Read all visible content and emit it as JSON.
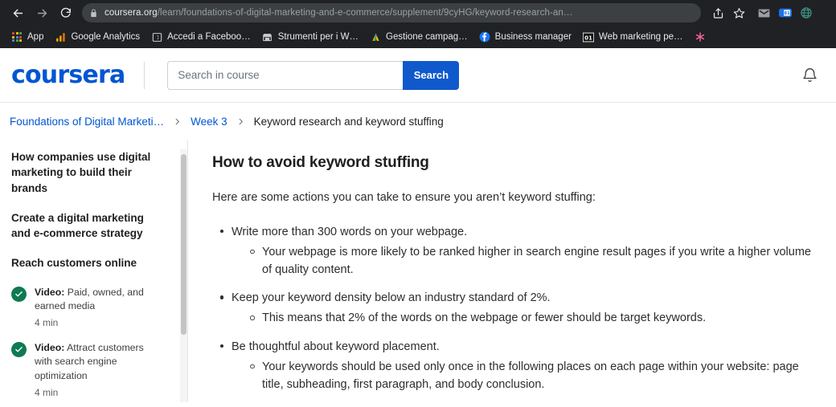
{
  "browser": {
    "back_icon": "back-arrow-icon",
    "forward_icon": "forward-arrow-icon",
    "reload_icon": "reload-icon",
    "lock_icon": "lock-icon",
    "url_host": "coursera.org",
    "url_path": "/learn/foundations-of-digital-marketing-and-e-commerce/supplement/9cyHG/keyword-research-an…",
    "url_full": "coursera.org/learn/foundations-of-digital-marketing-and-e-commerce/supplement/9cyHG/keyword-research-an…",
    "share_icon": "share-icon",
    "bookmark_icon": "star-icon",
    "extensions": [
      {
        "name": "gmail-extension-icon",
        "glyph": "M",
        "color": "#9aa0a6"
      },
      {
        "name": "blue-badge-extension-icon",
        "glyph": "81",
        "color": "#1a73e8"
      },
      {
        "name": "globe-extension-icon",
        "glyph": "globe",
        "color": "#3d9b8f"
      }
    ],
    "bookmarks": [
      {
        "label": "App",
        "icon": "apps-grid-icon"
      },
      {
        "label": "Google Analytics",
        "icon": "google-analytics-icon"
      },
      {
        "label": "Accedi a Faceboo…",
        "icon": "facebook-login-icon"
      },
      {
        "label": "Strumenti per i W…",
        "icon": "webmaster-tools-icon"
      },
      {
        "label": "Gestione campag…",
        "icon": "google-ads-icon"
      },
      {
        "label": "Business manager",
        "icon": "facebook-icon"
      },
      {
        "label": "Web marketing pe…",
        "icon": "numbered-01-icon"
      },
      {
        "label": "",
        "icon": "asterisk-icon"
      }
    ]
  },
  "header": {
    "logo_text": "coursera",
    "search": {
      "placeholder": "Search in course",
      "value": "",
      "button_label": "Search"
    },
    "notifications_icon": "bell-icon"
  },
  "breadcrumb": {
    "items": [
      {
        "label": "Foundations of Digital Marketi…",
        "current": false
      },
      {
        "label": "Week 3",
        "current": false
      },
      {
        "label": "Keyword research and keyword stuffing",
        "current": true
      }
    ],
    "separator_icon": "chevron-right-icon"
  },
  "sidebar": {
    "headings": [
      "How companies use digital marketing to build their brands",
      "Create a digital marketing and e-commerce strategy",
      "Reach customers online"
    ],
    "lessons": [
      {
        "status_icon": "check-circle-icon",
        "kind": "Video:",
        "title": " Paid, owned, and earned media",
        "duration": "4 min"
      },
      {
        "status_icon": "check-circle-icon",
        "kind": "Video:",
        "title": " Attract customers with search engine optimization",
        "duration": "4 min"
      }
    ],
    "scrollbar": "vertical-scrollbar"
  },
  "main": {
    "title": "How to avoid keyword stuffing",
    "intro": "Here are some actions you can take to ensure you aren’t keyword stuffing:",
    "bullets": [
      {
        "text": "Write more than 300 words on your webpage.",
        "sub": [
          "Your webpage is more likely to be ranked higher in search engine result pages if you write a higher volume of quality content."
        ]
      },
      {
        "text": "Keep your keyword density below an industry standard of 2%.",
        "sub": [
          "This means that 2% of the words on the webpage or fewer should be target keywords."
        ]
      },
      {
        "text": "Be thoughtful about keyword placement.",
        "sub": [
          "Your keywords should be used only once in the following places on each page within your website: page title, subheading, first paragraph, and body conclusion."
        ]
      }
    ]
  },
  "colors": {
    "coursera_blue": "#0056D2",
    "search_button_blue": "#1059CD",
    "complete_green": "#0F7A52",
    "chrome_dark": "#202124",
    "omnibox_bg": "#3c4043"
  }
}
